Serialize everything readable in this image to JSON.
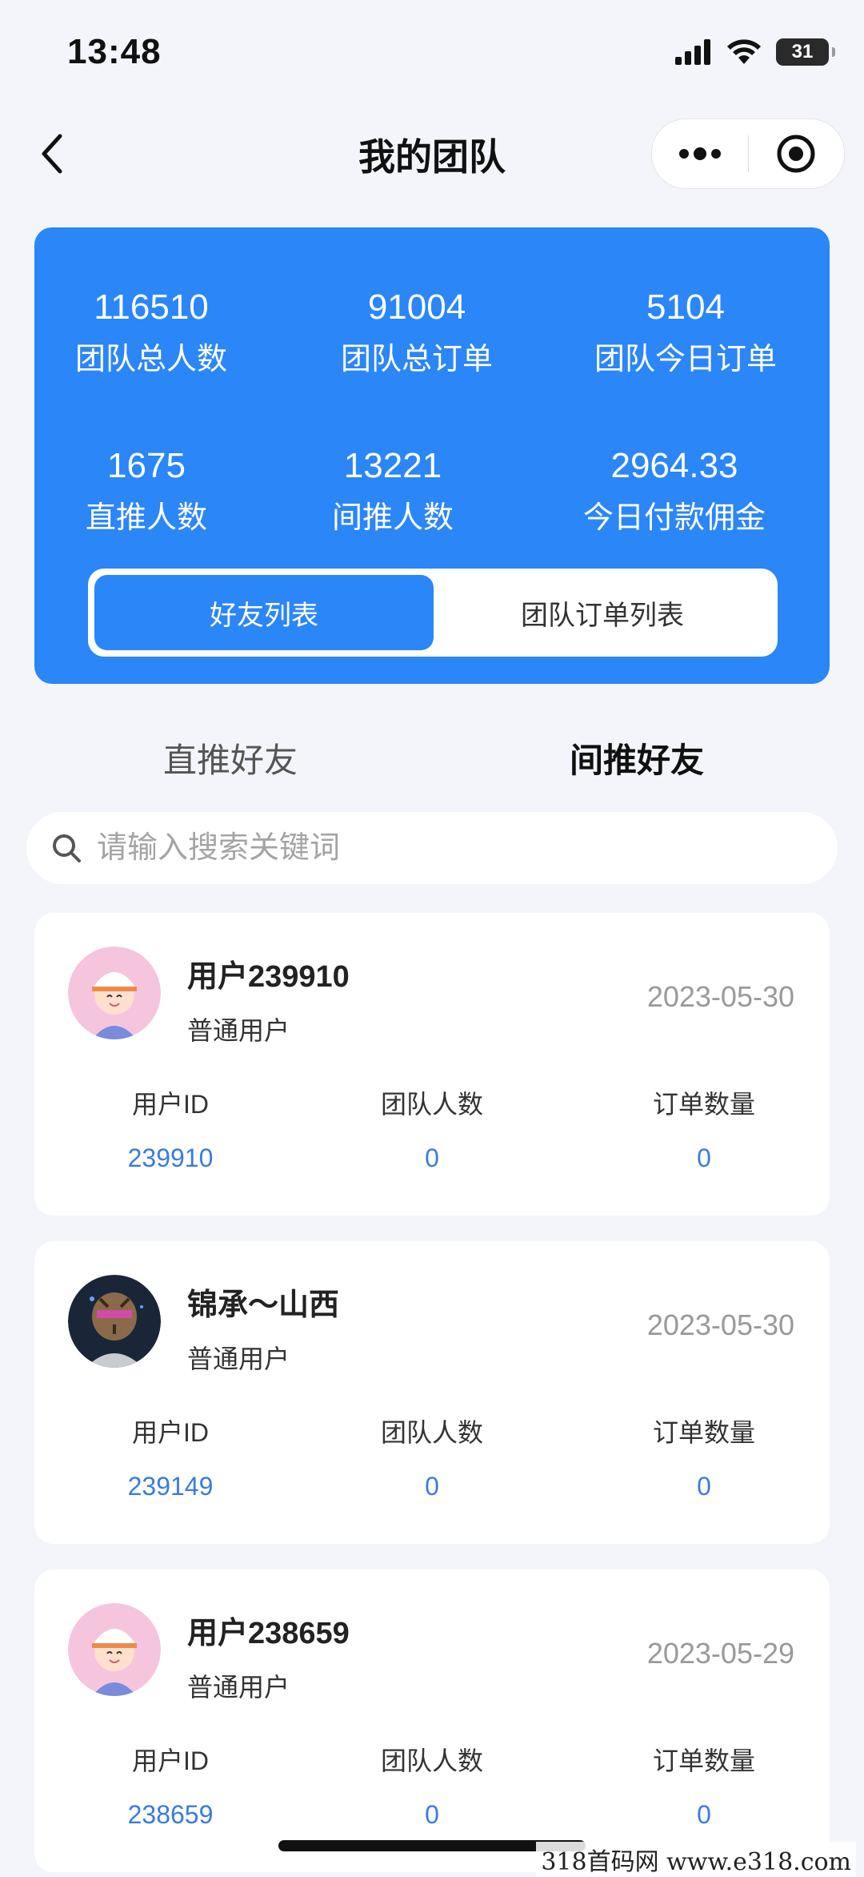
{
  "status_bar": {
    "time": "13:48",
    "battery": "31"
  },
  "nav": {
    "title": "我的团队"
  },
  "stats": [
    {
      "value": "116510",
      "label": "团队总人数"
    },
    {
      "value": "91004",
      "label": "团队总订单"
    },
    {
      "value": "5104",
      "label": "团队今日订单"
    },
    {
      "value": "1675",
      "label": "直推人数"
    },
    {
      "value": "13221",
      "label": "间推人数"
    },
    {
      "value": "2964.33",
      "label": "今日付款佣金"
    }
  ],
  "toggle": {
    "friends_list": "好友列表",
    "team_orders_list": "团队订单列表"
  },
  "subtabs": {
    "direct": "直推好友",
    "indirect": "间推好友"
  },
  "search": {
    "placeholder": "请输入搜索关键词"
  },
  "columns": {
    "user_id": "用户ID",
    "team_count": "团队人数",
    "order_count": "订单数量"
  },
  "users": [
    {
      "name": "用户239910",
      "role": "普通用户",
      "date": "2023-05-30",
      "id": "239910",
      "team": "0",
      "orders": "0"
    },
    {
      "name": "锦承～山西",
      "role": "普通用户",
      "date": "2023-05-30",
      "id": "239149",
      "team": "0",
      "orders": "0"
    },
    {
      "name": "用户238659",
      "role": "普通用户",
      "date": "2023-05-29",
      "id": "238659",
      "team": "0",
      "orders": "0"
    }
  ],
  "watermark": "318首码网  www.e318.com",
  "colors": {
    "primary": "#2b86f8",
    "id_text": "#3a7be0",
    "background": "#f4f5fa"
  }
}
